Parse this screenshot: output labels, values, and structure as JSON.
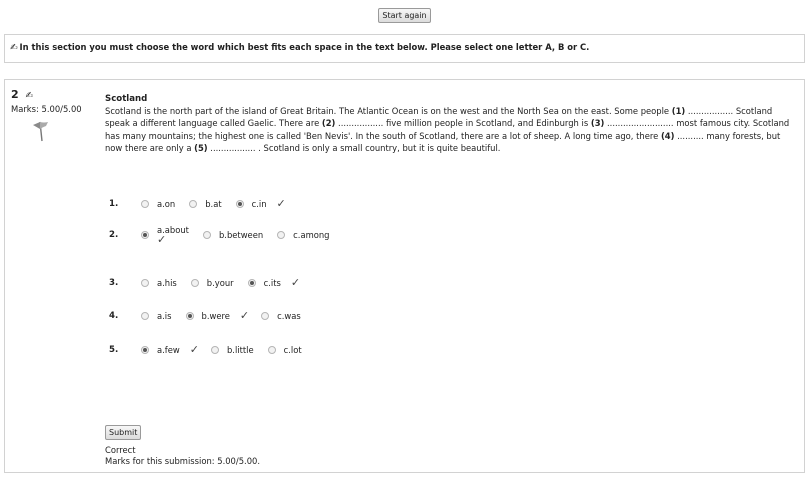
{
  "top": {
    "start_again": "Start again"
  },
  "intro": {
    "text": "In this section you must choose the word which best fits each space in the text below. Please select one letter A, B or C."
  },
  "question": {
    "number": "2",
    "marks": "Marks: 5.00/5.00",
    "title": "Scotland",
    "passage": [
      "Scotland is the north part of the island of Great Britain. The Atlantic Ocean is on the west and the North Sea on the east. Some people ",
      "(1)",
      " ................. Scotland speak a different language called Gaelic. There are ",
      "(2)",
      " ................. five million people in Scotland, and Edinburgh is ",
      "(3)",
      " ......................... most famous city. Scotland has many mountains; the highest one is called 'Ben Nevis'. In the south of Scotland, there are a lot of sheep. A long time ago, there ",
      "(4)",
      " .......... many forests, but now there are only a ",
      "(5)",
      " ................. . Scotland is only a small country, but it is quite beautiful."
    ],
    "answers": [
      {
        "num": "1.",
        "opts": [
          "a.on",
          "b.at",
          "c.in"
        ],
        "selected": 2
      },
      {
        "num": "2.",
        "opts": [
          "a.about",
          "b.between",
          "c.among"
        ],
        "selected": 0
      },
      {
        "num": "3.",
        "opts": [
          "a.his",
          "b.your",
          "c.its"
        ],
        "selected": 2
      },
      {
        "num": "4.",
        "opts": [
          "a.is",
          "b.were",
          "c.was"
        ],
        "selected": 1
      },
      {
        "num": "5.",
        "opts": [
          "a.few",
          "b.little",
          "c.lot"
        ],
        "selected": 0
      }
    ],
    "tick": "✓",
    "submit": "Submit",
    "result_status": "Correct",
    "result_marks": "Marks for this submission: 5.00/5.00."
  }
}
